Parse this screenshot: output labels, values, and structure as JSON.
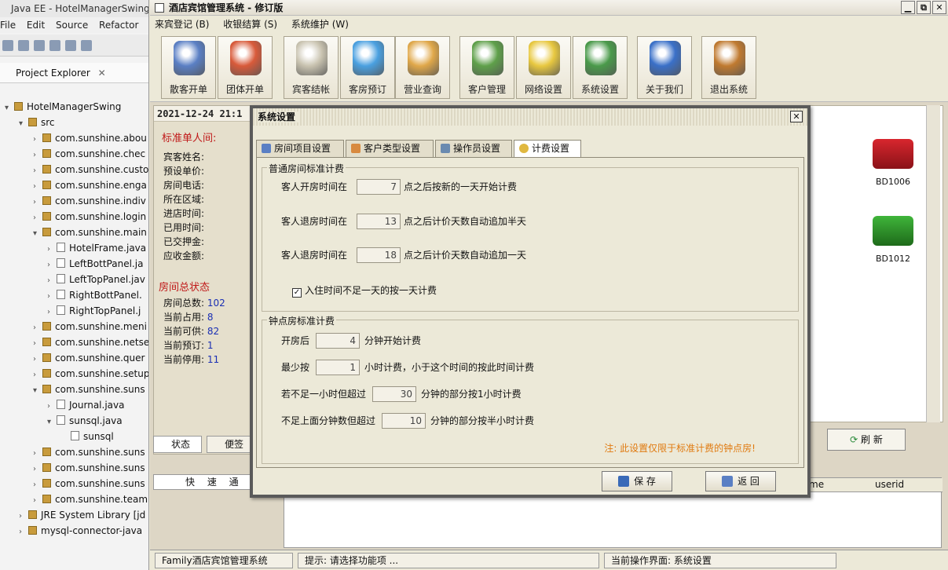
{
  "eclipse": {
    "title": "Java EE - HotelManagerSwing",
    "menu": [
      "File",
      "Edit",
      "Source",
      "Refactor"
    ],
    "project_explorer_label": "Project Explorer",
    "tree": [
      {
        "label": "HotelManagerSwing",
        "kind": "project",
        "indent": 0,
        "arrow": "▾"
      },
      {
        "label": "src",
        "kind": "folder",
        "indent": 1,
        "arrow": "▾"
      },
      {
        "label": "com.sunshine.abou",
        "kind": "package",
        "indent": 2,
        "arrow": "›"
      },
      {
        "label": "com.sunshine.chec",
        "kind": "package",
        "indent": 2,
        "arrow": "›"
      },
      {
        "label": "com.sunshine.custo",
        "kind": "package",
        "indent": 2,
        "arrow": "›"
      },
      {
        "label": "com.sunshine.enga",
        "kind": "package",
        "indent": 2,
        "arrow": "›"
      },
      {
        "label": "com.sunshine.indiv",
        "kind": "package",
        "indent": 2,
        "arrow": "›"
      },
      {
        "label": "com.sunshine.login",
        "kind": "package",
        "indent": 2,
        "arrow": "›"
      },
      {
        "label": "com.sunshine.main",
        "kind": "package",
        "indent": 2,
        "arrow": "▾"
      },
      {
        "label": "HotelFrame.java",
        "kind": "file",
        "indent": 3,
        "arrow": "›"
      },
      {
        "label": "LeftBottPanel.ja",
        "kind": "file",
        "indent": 3,
        "arrow": "›"
      },
      {
        "label": "LeftTopPanel.jav",
        "kind": "file",
        "indent": 3,
        "arrow": "›"
      },
      {
        "label": "RightBottPanel.",
        "kind": "file",
        "indent": 3,
        "arrow": "›"
      },
      {
        "label": "RightTopPanel.j",
        "kind": "file",
        "indent": 3,
        "arrow": "›"
      },
      {
        "label": "com.sunshine.meni",
        "kind": "package",
        "indent": 2,
        "arrow": "›"
      },
      {
        "label": "com.sunshine.netse",
        "kind": "package",
        "indent": 2,
        "arrow": "›"
      },
      {
        "label": "com.sunshine.quer",
        "kind": "package",
        "indent": 2,
        "arrow": "›"
      },
      {
        "label": "com.sunshine.setup",
        "kind": "package",
        "indent": 2,
        "arrow": "›"
      },
      {
        "label": "com.sunshine.suns",
        "kind": "package",
        "indent": 2,
        "arrow": "▾"
      },
      {
        "label": "Journal.java",
        "kind": "file",
        "indent": 3,
        "arrow": "›"
      },
      {
        "label": "sunsql.java",
        "kind": "file",
        "indent": 3,
        "arrow": "▾"
      },
      {
        "label": "sunsql",
        "kind": "class",
        "indent": 4,
        "arrow": ""
      },
      {
        "label": "com.sunshine.suns",
        "kind": "package",
        "indent": 2,
        "arrow": "›"
      },
      {
        "label": "com.sunshine.suns",
        "kind": "package",
        "indent": 2,
        "arrow": "›"
      },
      {
        "label": "com.sunshine.suns",
        "kind": "package",
        "indent": 2,
        "arrow": "›"
      },
      {
        "label": "com.sunshine.team",
        "kind": "package",
        "indent": 2,
        "arrow": "›"
      },
      {
        "label": "JRE System Library [jd",
        "kind": "library",
        "indent": 1,
        "arrow": "›"
      },
      {
        "label": "mysql-connector-java",
        "kind": "library",
        "indent": 1,
        "arrow": "›"
      }
    ]
  },
  "app": {
    "title": "酒店宾馆管理系统 - 修订版",
    "menu": [
      "来宾登记 (B)",
      "收银结算 (S)",
      "系统维护 (W)"
    ],
    "toolbar": [
      {
        "label": "散客开单",
        "icon": "person-icon",
        "color": "#5a7fc4"
      },
      {
        "label": "团体开单",
        "icon": "group-icon",
        "color": "#d85a3a"
      },
      {
        "label": "宾客结帐",
        "icon": "checkout-icon",
        "color": "#c9c3b0"
      },
      {
        "label": "客房预订",
        "icon": "compass-icon",
        "color": "#4aa0e0"
      },
      {
        "label": "营业查询",
        "icon": "search-icon",
        "color": "#e0a84a"
      },
      {
        "label": "客户管理",
        "icon": "customer-icon",
        "color": "#5fa04a"
      },
      {
        "label": "网络设置",
        "icon": "network-icon",
        "color": "#e8c840"
      },
      {
        "label": "系统设置",
        "icon": "settings-icon",
        "color": "#4a9a4a"
      },
      {
        "label": "关于我们",
        "icon": "about-icon",
        "color": "#3a70c8"
      },
      {
        "label": "退出系统",
        "icon": "exit-icon",
        "color": "#c07a30"
      }
    ],
    "datetime": "2021-12-24  21:1",
    "room_info": {
      "heading": "标准单人间:",
      "fields": [
        "宾客姓名:",
        "预设单价:",
        "房间电话:",
        "所在区域:",
        "进店时间:",
        "已用时间:",
        "已交押金:",
        "应收金额:"
      ]
    },
    "room_status": {
      "heading": "房间总状态",
      "items": [
        {
          "label": "房间总数:",
          "value": "102"
        },
        {
          "label": "当前占用:",
          "value": "8"
        },
        {
          "label": "当前可供:",
          "value": "82"
        },
        {
          "label": "当前预订:",
          "value": "1"
        },
        {
          "label": "当前停用:",
          "value": "11"
        }
      ]
    },
    "left_tabs": [
      "状态",
      "便签"
    ],
    "rooms": [
      {
        "id": "BD1006",
        "color": "#d8262e"
      },
      {
        "id": "BD1012",
        "color": "#3fb53a"
      }
    ],
    "refresh_label": "刷 新",
    "quick_label": "快 速 通 道",
    "grid_headers": [
      "me",
      "userid"
    ],
    "statusbar": [
      "Family酒店宾馆管理系统",
      "提示: 请选择功能项 ...",
      "当前操作界面: 系统设置"
    ]
  },
  "dialog": {
    "title": "系统设置",
    "tabs": [
      "房间项目设置",
      "客户类型设置",
      "操作员设置",
      "计费设置"
    ],
    "active_tab": "计费设置",
    "standard": {
      "group_title": "普通房间标准计费",
      "row1": {
        "prefix": "客人开房时间在",
        "value": "7",
        "suffix": "点之后按新的一天开始计费"
      },
      "row2": {
        "prefix": "客人退房时间在",
        "value": "13",
        "suffix": "点之后计价天数自动追加半天"
      },
      "row3": {
        "prefix": "客人退房时间在",
        "value": "18",
        "suffix": "点之后计价天数自动追加一天"
      },
      "checkbox": {
        "label": "入住时间不足一天的按一天计费",
        "checked": true
      }
    },
    "hourly": {
      "group_title": "钟点房标准计费",
      "row1": {
        "prefix": "开房后",
        "value": "4",
        "suffix": "分钟开始计费"
      },
      "row2": {
        "prefix": "最少按",
        "value": "1",
        "suffix": "小时计费，小于这个时间的按此时间计费"
      },
      "row3": {
        "prefix": "若不足一小时但超过",
        "value": "30",
        "suffix": "分钟的部分按1小时计费"
      },
      "row4": {
        "prefix": "不足上面分钟数但超过",
        "value": "10",
        "suffix": "分钟的部分按半小时计费"
      }
    },
    "note": "注: 此设置仅限于标准计费的钟点房!",
    "save_label": "保 存",
    "back_label": "返 回"
  }
}
